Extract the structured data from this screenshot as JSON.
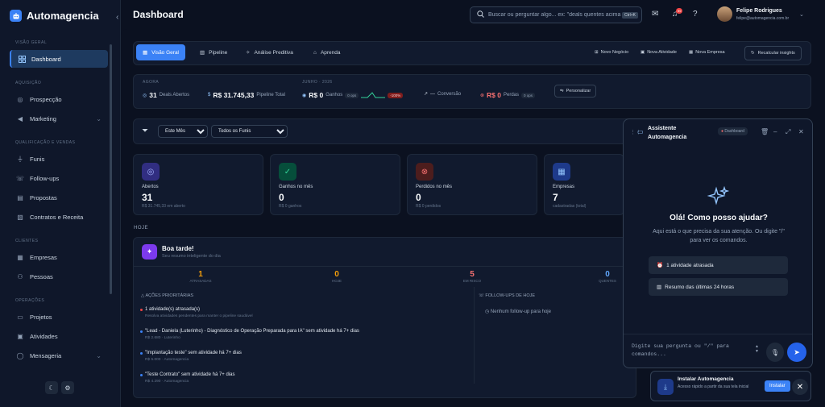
{
  "brand": {
    "name": "Automagencia"
  },
  "sidebar": {
    "sections": [
      {
        "title": "VISÃO GERAL",
        "items": [
          {
            "label": "Dashboard",
            "icon": "dashboard-icon",
            "active": true
          }
        ]
      },
      {
        "title": "AQUISIÇÃO",
        "items": [
          {
            "label": "Prospecção",
            "icon": "target-icon"
          },
          {
            "label": "Marketing",
            "icon": "megaphone-icon",
            "expandable": true
          }
        ]
      },
      {
        "title": "QUALIFICAÇÃO E VENDAS",
        "items": [
          {
            "label": "Funis",
            "icon": "funnel-icon"
          },
          {
            "label": "Follow-ups",
            "icon": "phone-icon"
          },
          {
            "label": "Propostas",
            "icon": "document-icon"
          },
          {
            "label": "Contratos e Receita",
            "icon": "contract-icon"
          }
        ]
      },
      {
        "title": "CLIENTES",
        "items": [
          {
            "label": "Empresas",
            "icon": "building-icon"
          },
          {
            "label": "Pessoas",
            "icon": "people-icon"
          }
        ]
      },
      {
        "title": "OPERAÇÕES",
        "items": [
          {
            "label": "Projetos",
            "icon": "folder-icon"
          },
          {
            "label": "Atividades",
            "icon": "calendar-icon"
          },
          {
            "label": "Mensageria",
            "icon": "chat-icon",
            "expandable": true
          }
        ]
      }
    ]
  },
  "header": {
    "title": "Dashboard",
    "search_placeholder": "Buscar ou perguntar algo... ex: \"deals quentes acima de",
    "search_shortcut": "Ctrl+K",
    "notification_count": "99",
    "user_name": "Felipe Rodrigues",
    "user_email": "felipe@automagencia.com.br"
  },
  "tabs": [
    {
      "label": "Visão Geral",
      "icon": "grid-icon",
      "active": true
    },
    {
      "label": "Pipeline",
      "icon": "bar-chart-icon"
    },
    {
      "label": "Análise Preditiva",
      "icon": "sparkle-icon"
    },
    {
      "label": "Aprenda",
      "icon": "graduation-icon"
    }
  ],
  "quick_actions": [
    {
      "label": "Novo Negócio",
      "icon": "deal-icon"
    },
    {
      "label": "Nova Atividade",
      "icon": "calendar-icon"
    },
    {
      "label": "Nova Empresa",
      "icon": "building-icon"
    }
  ],
  "recalc_label": "Recalcular insights",
  "kpis": {
    "now_label": "AGORA",
    "month_label": "JUNHO · 2026",
    "deals_value": "31",
    "deals_label": "Deals Abertos",
    "pipeline_value": "R$ 31.745,33",
    "pipeline_label": "Pipeline Total",
    "won_value": "R$ 0",
    "won_label": "Ganhos",
    "won_chip": "0 ops",
    "trend_chip": "-100%",
    "conversion_value": "—",
    "conversion_label": "Conversão",
    "lost_value": "R$ 0",
    "lost_label": "Perdas",
    "lost_chip": "0 ops",
    "customize_label": "Personalizar"
  },
  "filters": {
    "period": "Este Mês",
    "funnel": "Todos os Funis"
  },
  "stats": [
    {
      "label": "Abertos",
      "value": "31",
      "sub": "R$ 31.745,33 em aberto",
      "icon": "target-icon",
      "color": "#6366f1"
    },
    {
      "label": "Ganhos no mês",
      "value": "0",
      "sub": "R$ 0 ganhos",
      "icon": "check-circle-icon",
      "color": "#10b981"
    },
    {
      "label": "Perdidos no mês",
      "value": "0",
      "sub": "R$ 0 perdidos",
      "icon": "x-circle-icon",
      "color": "#ef4444"
    },
    {
      "label": "Empresas",
      "value": "7",
      "sub": "cadastradas (total)",
      "icon": "building-icon",
      "color": "#3b82f6"
    }
  ],
  "today": {
    "section_label": "HOJE",
    "greeting": "Boa tarde!",
    "greeting_sub": "Seu resumo inteligente do dia",
    "metrics": [
      {
        "value": "1",
        "label": "ATRASADAS",
        "color": "#f59e0b"
      },
      {
        "value": "0",
        "label": "HOJE",
        "color": "#f59e0b"
      },
      {
        "value": "5",
        "label": "EM RISCO",
        "color": "#f87171"
      },
      {
        "value": "0",
        "label": "QUENTES",
        "color": "#60a5fa"
      }
    ],
    "priority_title": "AÇÕES PRIORITÁRIAS",
    "priority_items": [
      {
        "title": "1 atividade(s) atrasada(s)",
        "sub": "Resolva atividades pendentes para manter o pipeline saudável",
        "color": "#ef4444"
      },
      {
        "title": "\"Lead - Daniela (Luterinho) - Diagnóstico de Operação Preparada para IA\" sem atividade há 7+ dias",
        "sub": "R$ 2.680 · Luterinho",
        "color": "#3b82f6"
      },
      {
        "title": "\"Implantação teste\" sem atividade há 7+ dias",
        "sub": "R$ 5.000 · Automagencia",
        "color": "#3b82f6"
      },
      {
        "title": "\"Teste Contrato\" sem atividade há 7+ dias",
        "sub": "R$ 4.290 · Automagencia",
        "color": "#3b82f6"
      }
    ],
    "followup_title": "FOLLOW-UPS DE HOJE",
    "followup_empty": "Nenhum follow-up para hoje"
  },
  "assistant": {
    "title_line1": "Assistente",
    "title_line2": "Automagencia",
    "context_chip": "Dashboard",
    "greeting": "Olá! Como posso ajudar?",
    "description": "Aqui está o que precisa da sua atenção. Ou digite \"/\" para ver os comandos.",
    "suggestions": [
      {
        "icon": "alarm-icon",
        "label": "1 atividade atrasada"
      },
      {
        "icon": "chart-icon",
        "label": "Resumo das últimas 24 horas"
      }
    ],
    "input_placeholder": "Digite sua pergunta ou \"/\" para comandos..."
  },
  "install": {
    "title": "Instalar Automagencia",
    "sub": "Acesso rápido a partir da sua tela inicial",
    "button": "Instalar"
  }
}
